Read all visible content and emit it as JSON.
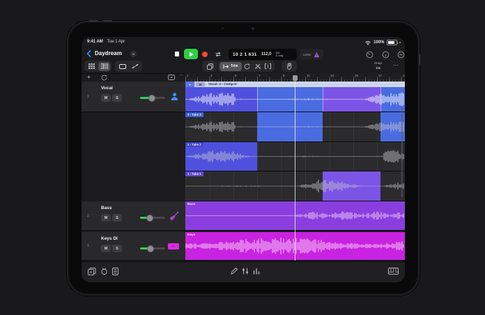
{
  "colors": {
    "accent-blue": "#3f8ef7",
    "play-green": "#2fd045",
    "record-red": "#ff453a",
    "metronome-purple": "#a55ce8",
    "slider-green": "#34d158",
    "take1": "#7b55e6",
    "take2": "#4f51de",
    "take3": "#4a6ce0",
    "tag1": "#6747d2",
    "tag2": "#4345cc",
    "tag3": "#3f5fd6",
    "comp-header": "#ccd5ec",
    "bass-region": "#8a3ede",
    "keys-region": "#c823e0",
    "bass-icon": "#b44ef0",
    "keys-badge": "#d92ae4"
  },
  "status_bar": {
    "time": "9:41 AM",
    "date": "Tue 1 Apr",
    "battery": "100%"
  },
  "toolbar": {
    "title": "Daydream",
    "lcd": {
      "position": "10 2 1 631",
      "tempo": "112,0",
      "time_sig": "4/4",
      "key": "C maj"
    },
    "count_in": "1234"
  },
  "edit_bar": {
    "trim": "Trim",
    "snap_label": "Snap",
    "snap_value": "1/4",
    "more": "…"
  },
  "track_area": {
    "add": "+",
    "more": "…"
  },
  "ruler": {
    "bars": [
      "1",
      "3",
      "5",
      "7",
      "9",
      "11",
      "13",
      "15",
      "17",
      "19"
    ]
  },
  "tracks": [
    {
      "num": "1",
      "name": "Vocal",
      "mute": "M",
      "solo": "S",
      "icon": "vocalist-icon"
    },
    {
      "num": "2",
      "name": "Bass",
      "mute": "M",
      "solo": "S",
      "icon": "bass-guitar-icon"
    },
    {
      "num": "3",
      "name": "Keys DI",
      "mute": "M",
      "solo": "S",
      "icon": "keys-badge-icon"
    }
  ],
  "arrange": {
    "comp_region": {
      "comp_letter": "D",
      "title": "Vocal: 2 - Comp D"
    },
    "takes": [
      {
        "label": "3 - Take 3"
      },
      {
        "label": "2 - Take 2"
      },
      {
        "label": "1 - Take 1"
      }
    ],
    "bass_label": "Bass",
    "keys_label": "Keys"
  }
}
